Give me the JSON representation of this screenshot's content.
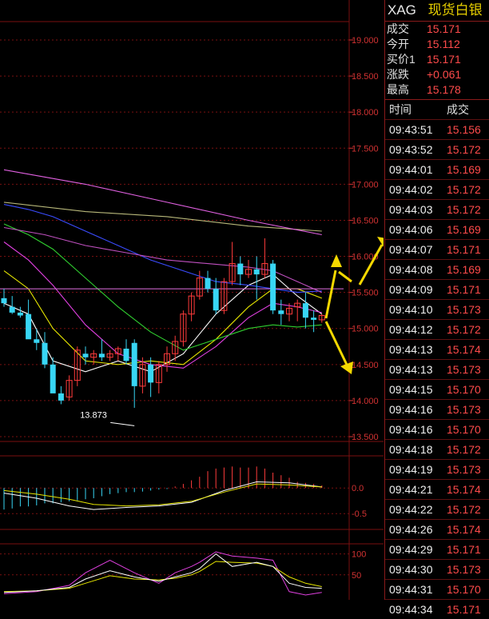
{
  "quote": {
    "symbol": "XAG",
    "name": "现货白银",
    "fields": [
      {
        "label": "成交",
        "value": "15.171"
      },
      {
        "label": "今开",
        "value": "15.112"
      },
      {
        "label": "买价1",
        "value": "15.171"
      },
      {
        "label": "涨跌",
        "value": "+0.061"
      },
      {
        "label": "最高",
        "value": "15.178"
      }
    ]
  },
  "ticks": {
    "headers": {
      "time": "时间",
      "price": "成交"
    },
    "rows": [
      {
        "time": "09:43:51",
        "price": "15.156"
      },
      {
        "time": "09:43:52",
        "price": "15.172"
      },
      {
        "time": "09:44:01",
        "price": "15.169"
      },
      {
        "time": "09:44:02",
        "price": "15.172"
      },
      {
        "time": "09:44:03",
        "price": "15.172"
      },
      {
        "time": "09:44:06",
        "price": "15.169"
      },
      {
        "time": "09:44:07",
        "price": "15.171"
      },
      {
        "time": "09:44:08",
        "price": "15.169"
      },
      {
        "time": "09:44:09",
        "price": "15.171"
      },
      {
        "time": "09:44:10",
        "price": "15.173"
      },
      {
        "time": "09:44:12",
        "price": "15.172"
      },
      {
        "time": "09:44:13",
        "price": "15.174"
      },
      {
        "time": "09:44:13",
        "price": "15.173"
      },
      {
        "time": "09:44:15",
        "price": "15.170"
      },
      {
        "time": "09:44:16",
        "price": "15.173"
      },
      {
        "time": "09:44:16",
        "price": "15.170"
      },
      {
        "time": "09:44:18",
        "price": "15.172"
      },
      {
        "time": "09:44:19",
        "price": "15.173"
      },
      {
        "time": "09:44:21",
        "price": "15.174"
      },
      {
        "time": "09:44:22",
        "price": "15.172"
      },
      {
        "time": "09:44:26",
        "price": "15.174"
      },
      {
        "time": "09:44:29",
        "price": "15.171"
      },
      {
        "time": "09:44:30",
        "price": "15.173"
      },
      {
        "time": "09:44:31",
        "price": "15.170"
      },
      {
        "time": "09:44:34",
        "price": "15.171"
      }
    ]
  },
  "chart": {
    "price_axis_labels": [
      "19.000",
      "18.500",
      "18.000",
      "17.500",
      "17.000",
      "16.500",
      "16.000",
      "15.500",
      "15.000",
      "14.500",
      "14.000",
      "13.500"
    ],
    "price_levels": [
      19.0,
      18.5,
      18.0,
      17.5,
      17.0,
      16.5,
      16.0,
      15.5,
      15.0,
      14.5,
      14.0,
      13.5
    ],
    "macd_axis_labels": [
      "0.0",
      "-0.5"
    ],
    "macd_levels": [
      0.0,
      -0.5
    ],
    "kdj_axis_labels": [
      "100",
      "50"
    ],
    "kdj_levels": [
      100,
      50
    ],
    "low_annotation": "13.873",
    "low_value": 13.873,
    "colors": {
      "up": "#ff3b3b",
      "down": "#38d6f5",
      "grid": "#7a1010",
      "axis_text": "#d23232"
    },
    "candles": [
      {
        "o": 15.42,
        "h": 15.55,
        "l": 15.3,
        "c": 15.35
      },
      {
        "o": 15.3,
        "h": 15.45,
        "l": 15.2,
        "c": 15.22
      },
      {
        "o": 15.22,
        "h": 15.3,
        "l": 15.15,
        "c": 15.18
      },
      {
        "o": 15.2,
        "h": 15.4,
        "l": 15.1,
        "c": 14.85
      },
      {
        "o": 14.85,
        "h": 15.0,
        "l": 14.7,
        "c": 14.8
      },
      {
        "o": 14.8,
        "h": 14.95,
        "l": 14.45,
        "c": 14.5
      },
      {
        "o": 14.5,
        "h": 14.6,
        "l": 14.2,
        "c": 14.1
      },
      {
        "o": 14.1,
        "h": 14.2,
        "l": 13.95,
        "c": 14.0
      },
      {
        "o": 14.05,
        "h": 14.35,
        "l": 14.0,
        "c": 14.28
      },
      {
        "o": 14.28,
        "h": 14.75,
        "l": 14.2,
        "c": 14.7
      },
      {
        "o": 14.65,
        "h": 14.75,
        "l": 14.5,
        "c": 14.6
      },
      {
        "o": 14.6,
        "h": 14.7,
        "l": 14.5,
        "c": 14.65
      },
      {
        "o": 14.65,
        "h": 14.85,
        "l": 14.55,
        "c": 14.6
      },
      {
        "o": 14.6,
        "h": 14.7,
        "l": 14.55,
        "c": 14.65
      },
      {
        "o": 14.65,
        "h": 14.75,
        "l": 14.55,
        "c": 14.72
      },
      {
        "o": 14.72,
        "h": 14.85,
        "l": 14.5,
        "c": 14.55
      },
      {
        "o": 14.8,
        "h": 14.85,
        "l": 13.9,
        "c": 14.2
      },
      {
        "o": 14.2,
        "h": 14.6,
        "l": 14.1,
        "c": 14.5
      },
      {
        "o": 14.5,
        "h": 14.6,
        "l": 14.05,
        "c": 14.25
      },
      {
        "o": 14.25,
        "h": 14.55,
        "l": 14.1,
        "c": 14.5
      },
      {
        "o": 14.5,
        "h": 14.75,
        "l": 14.4,
        "c": 14.65
      },
      {
        "o": 14.65,
        "h": 14.9,
        "l": 14.55,
        "c": 14.82
      },
      {
        "o": 14.82,
        "h": 15.25,
        "l": 14.75,
        "c": 15.2
      },
      {
        "o": 15.2,
        "h": 15.5,
        "l": 15.1,
        "c": 15.45
      },
      {
        "o": 15.45,
        "h": 15.8,
        "l": 15.4,
        "c": 15.7
      },
      {
        "o": 15.7,
        "h": 15.8,
        "l": 15.5,
        "c": 15.55
      },
      {
        "o": 15.55,
        "h": 15.7,
        "l": 15.2,
        "c": 15.25
      },
      {
        "o": 15.25,
        "h": 15.7,
        "l": 15.2,
        "c": 15.65
      },
      {
        "o": 15.65,
        "h": 16.2,
        "l": 15.6,
        "c": 15.9
      },
      {
        "o": 15.9,
        "h": 16.0,
        "l": 15.6,
        "c": 15.75
      },
      {
        "o": 15.75,
        "h": 15.95,
        "l": 15.7,
        "c": 15.82
      },
      {
        "o": 15.82,
        "h": 16.0,
        "l": 15.4,
        "c": 15.75
      },
      {
        "o": 15.75,
        "h": 16.25,
        "l": 15.7,
        "c": 15.9
      },
      {
        "o": 15.9,
        "h": 15.95,
        "l": 15.2,
        "c": 15.25
      },
      {
        "o": 15.25,
        "h": 15.4,
        "l": 15.05,
        "c": 15.2
      },
      {
        "o": 15.2,
        "h": 15.35,
        "l": 15.1,
        "c": 15.28
      },
      {
        "o": 15.3,
        "h": 15.4,
        "l": 15.1,
        "c": 15.35
      },
      {
        "o": 15.35,
        "h": 15.5,
        "l": 15.0,
        "c": 15.15
      },
      {
        "o": 15.15,
        "h": 15.25,
        "l": 14.95,
        "c": 15.12
      },
      {
        "o": 15.12,
        "h": 15.2,
        "l": 15.08,
        "c": 15.18
      }
    ],
    "ma": [
      {
        "color": "#ffffff",
        "points": [
          [
            0,
            15.35
          ],
          [
            3,
            15.2
          ],
          [
            6,
            14.55
          ],
          [
            10,
            14.4
          ],
          [
            14,
            14.55
          ],
          [
            18,
            14.4
          ],
          [
            22,
            14.65
          ],
          [
            26,
            15.2
          ],
          [
            30,
            15.6
          ],
          [
            33,
            15.75
          ],
          [
            36,
            15.45
          ],
          [
            39,
            15.2
          ]
        ]
      },
      {
        "color": "#e6e600",
        "points": [
          [
            0,
            15.8
          ],
          [
            3,
            15.55
          ],
          [
            6,
            15.0
          ],
          [
            10,
            14.55
          ],
          [
            14,
            14.5
          ],
          [
            18,
            14.55
          ],
          [
            22,
            14.5
          ],
          [
            26,
            14.85
          ],
          [
            30,
            15.3
          ],
          [
            33,
            15.55
          ],
          [
            36,
            15.55
          ],
          [
            39,
            15.42
          ]
        ]
      },
      {
        "color": "#e040e0",
        "points": [
          [
            0,
            16.2
          ],
          [
            3,
            15.95
          ],
          [
            6,
            15.6
          ],
          [
            10,
            15.05
          ],
          [
            14,
            14.65
          ],
          [
            18,
            14.5
          ],
          [
            22,
            14.45
          ],
          [
            26,
            14.75
          ],
          [
            30,
            15.15
          ],
          [
            33,
            15.35
          ],
          [
            36,
            15.3
          ],
          [
            39,
            15.22
          ]
        ]
      },
      {
        "color": "#30d030",
        "points": [
          [
            0,
            16.45
          ],
          [
            3,
            16.3
          ],
          [
            6,
            16.1
          ],
          [
            10,
            15.7
          ],
          [
            14,
            15.3
          ],
          [
            18,
            14.95
          ],
          [
            22,
            14.7
          ],
          [
            26,
            14.85
          ],
          [
            30,
            15.0
          ],
          [
            33,
            15.05
          ],
          [
            36,
            15.02
          ],
          [
            39,
            15.05
          ]
        ]
      },
      {
        "color": "#3a4cff",
        "points": [
          [
            0,
            16.72
          ],
          [
            3,
            16.65
          ],
          [
            6,
            16.55
          ],
          [
            10,
            16.35
          ],
          [
            14,
            16.15
          ],
          [
            18,
            15.95
          ],
          [
            22,
            15.8
          ],
          [
            26,
            15.65
          ],
          [
            30,
            15.6
          ],
          [
            33,
            15.55
          ],
          [
            36,
            15.5
          ],
          [
            39,
            15.52
          ]
        ]
      },
      {
        "color": "#b8b87a",
        "points": [
          [
            0,
            16.75
          ],
          [
            10,
            16.62
          ],
          [
            20,
            16.55
          ],
          [
            30,
            16.42
          ],
          [
            39,
            16.35
          ]
        ]
      },
      {
        "color": "#e060e0",
        "points": [
          [
            0,
            17.2
          ],
          [
            10,
            17.0
          ],
          [
            20,
            16.75
          ],
          [
            30,
            16.5
          ],
          [
            39,
            16.3
          ]
        ]
      },
      {
        "color": "#c050c0",
        "points": [
          [
            0,
            16.4
          ],
          [
            5,
            16.3
          ],
          [
            10,
            16.15
          ],
          [
            15,
            16.05
          ],
          [
            20,
            15.95
          ],
          [
            25,
            15.9
          ],
          [
            30,
            15.85
          ],
          [
            33,
            15.8
          ],
          [
            36,
            15.65
          ],
          [
            39,
            15.5
          ]
        ]
      }
    ],
    "hline_value": 15.55,
    "macd_hist": [
      -0.42,
      -0.4,
      -0.36,
      -0.36,
      -0.34,
      -0.3,
      -0.3,
      -0.28,
      -0.26,
      -0.24,
      -0.22,
      -0.2,
      -0.16,
      -0.12,
      -0.1,
      -0.08,
      -0.08,
      -0.07,
      -0.05,
      -0.03,
      -0.02,
      0.03,
      0.08,
      0.15,
      0.22,
      0.33,
      0.38,
      0.4,
      0.42,
      0.4,
      0.4,
      0.42,
      0.38,
      0.3,
      0.25,
      0.2,
      0.12,
      0.1,
      0.08,
      0.05
    ],
    "macd_dif": [
      [
        0,
        -0.1
      ],
      [
        4,
        -0.2
      ],
      [
        8,
        -0.35
      ],
      [
        11,
        -0.42
      ],
      [
        15,
        -0.38
      ],
      [
        19,
        -0.35
      ],
      [
        23,
        -0.28
      ],
      [
        27,
        -0.05
      ],
      [
        31,
        0.12
      ],
      [
        35,
        0.1
      ],
      [
        39,
        0.02
      ]
    ],
    "macd_dea": [
      [
        0,
        -0.05
      ],
      [
        4,
        -0.12
      ],
      [
        8,
        -0.22
      ],
      [
        11,
        -0.32
      ],
      [
        15,
        -0.35
      ],
      [
        19,
        -0.33
      ],
      [
        23,
        -0.26
      ],
      [
        27,
        -0.08
      ],
      [
        31,
        0.08
      ],
      [
        35,
        0.06
      ],
      [
        39,
        0.02
      ]
    ],
    "kdj_k": [
      [
        0,
        8
      ],
      [
        4,
        12
      ],
      [
        8,
        20
      ],
      [
        10,
        40
      ],
      [
        13,
        60
      ],
      [
        16,
        45
      ],
      [
        19,
        35
      ],
      [
        21,
        45
      ],
      [
        23,
        55
      ],
      [
        24,
        65
      ],
      [
        26,
        100
      ],
      [
        28,
        70
      ],
      [
        31,
        80
      ],
      [
        33,
        70
      ],
      [
        35,
        30
      ],
      [
        37,
        20
      ],
      [
        39,
        18
      ]
    ],
    "kdj_d": [
      [
        0,
        10
      ],
      [
        4,
        12
      ],
      [
        8,
        18
      ],
      [
        10,
        30
      ],
      [
        13,
        48
      ],
      [
        16,
        40
      ],
      [
        19,
        38
      ],
      [
        21,
        42
      ],
      [
        23,
        50
      ],
      [
        24,
        58
      ],
      [
        26,
        82
      ],
      [
        28,
        80
      ],
      [
        31,
        78
      ],
      [
        33,
        70
      ],
      [
        35,
        45
      ],
      [
        37,
        30
      ],
      [
        39,
        22
      ]
    ],
    "kdj_j": [
      [
        0,
        5
      ],
      [
        4,
        10
      ],
      [
        8,
        25
      ],
      [
        10,
        55
      ],
      [
        13,
        85
      ],
      [
        16,
        55
      ],
      [
        19,
        30
      ],
      [
        21,
        55
      ],
      [
        23,
        70
      ],
      [
        24,
        80
      ],
      [
        26,
        115
      ],
      [
        28,
        95
      ],
      [
        31,
        90
      ],
      [
        33,
        85
      ],
      [
        35,
        10
      ],
      [
        37,
        2
      ],
      [
        39,
        8
      ]
    ]
  }
}
